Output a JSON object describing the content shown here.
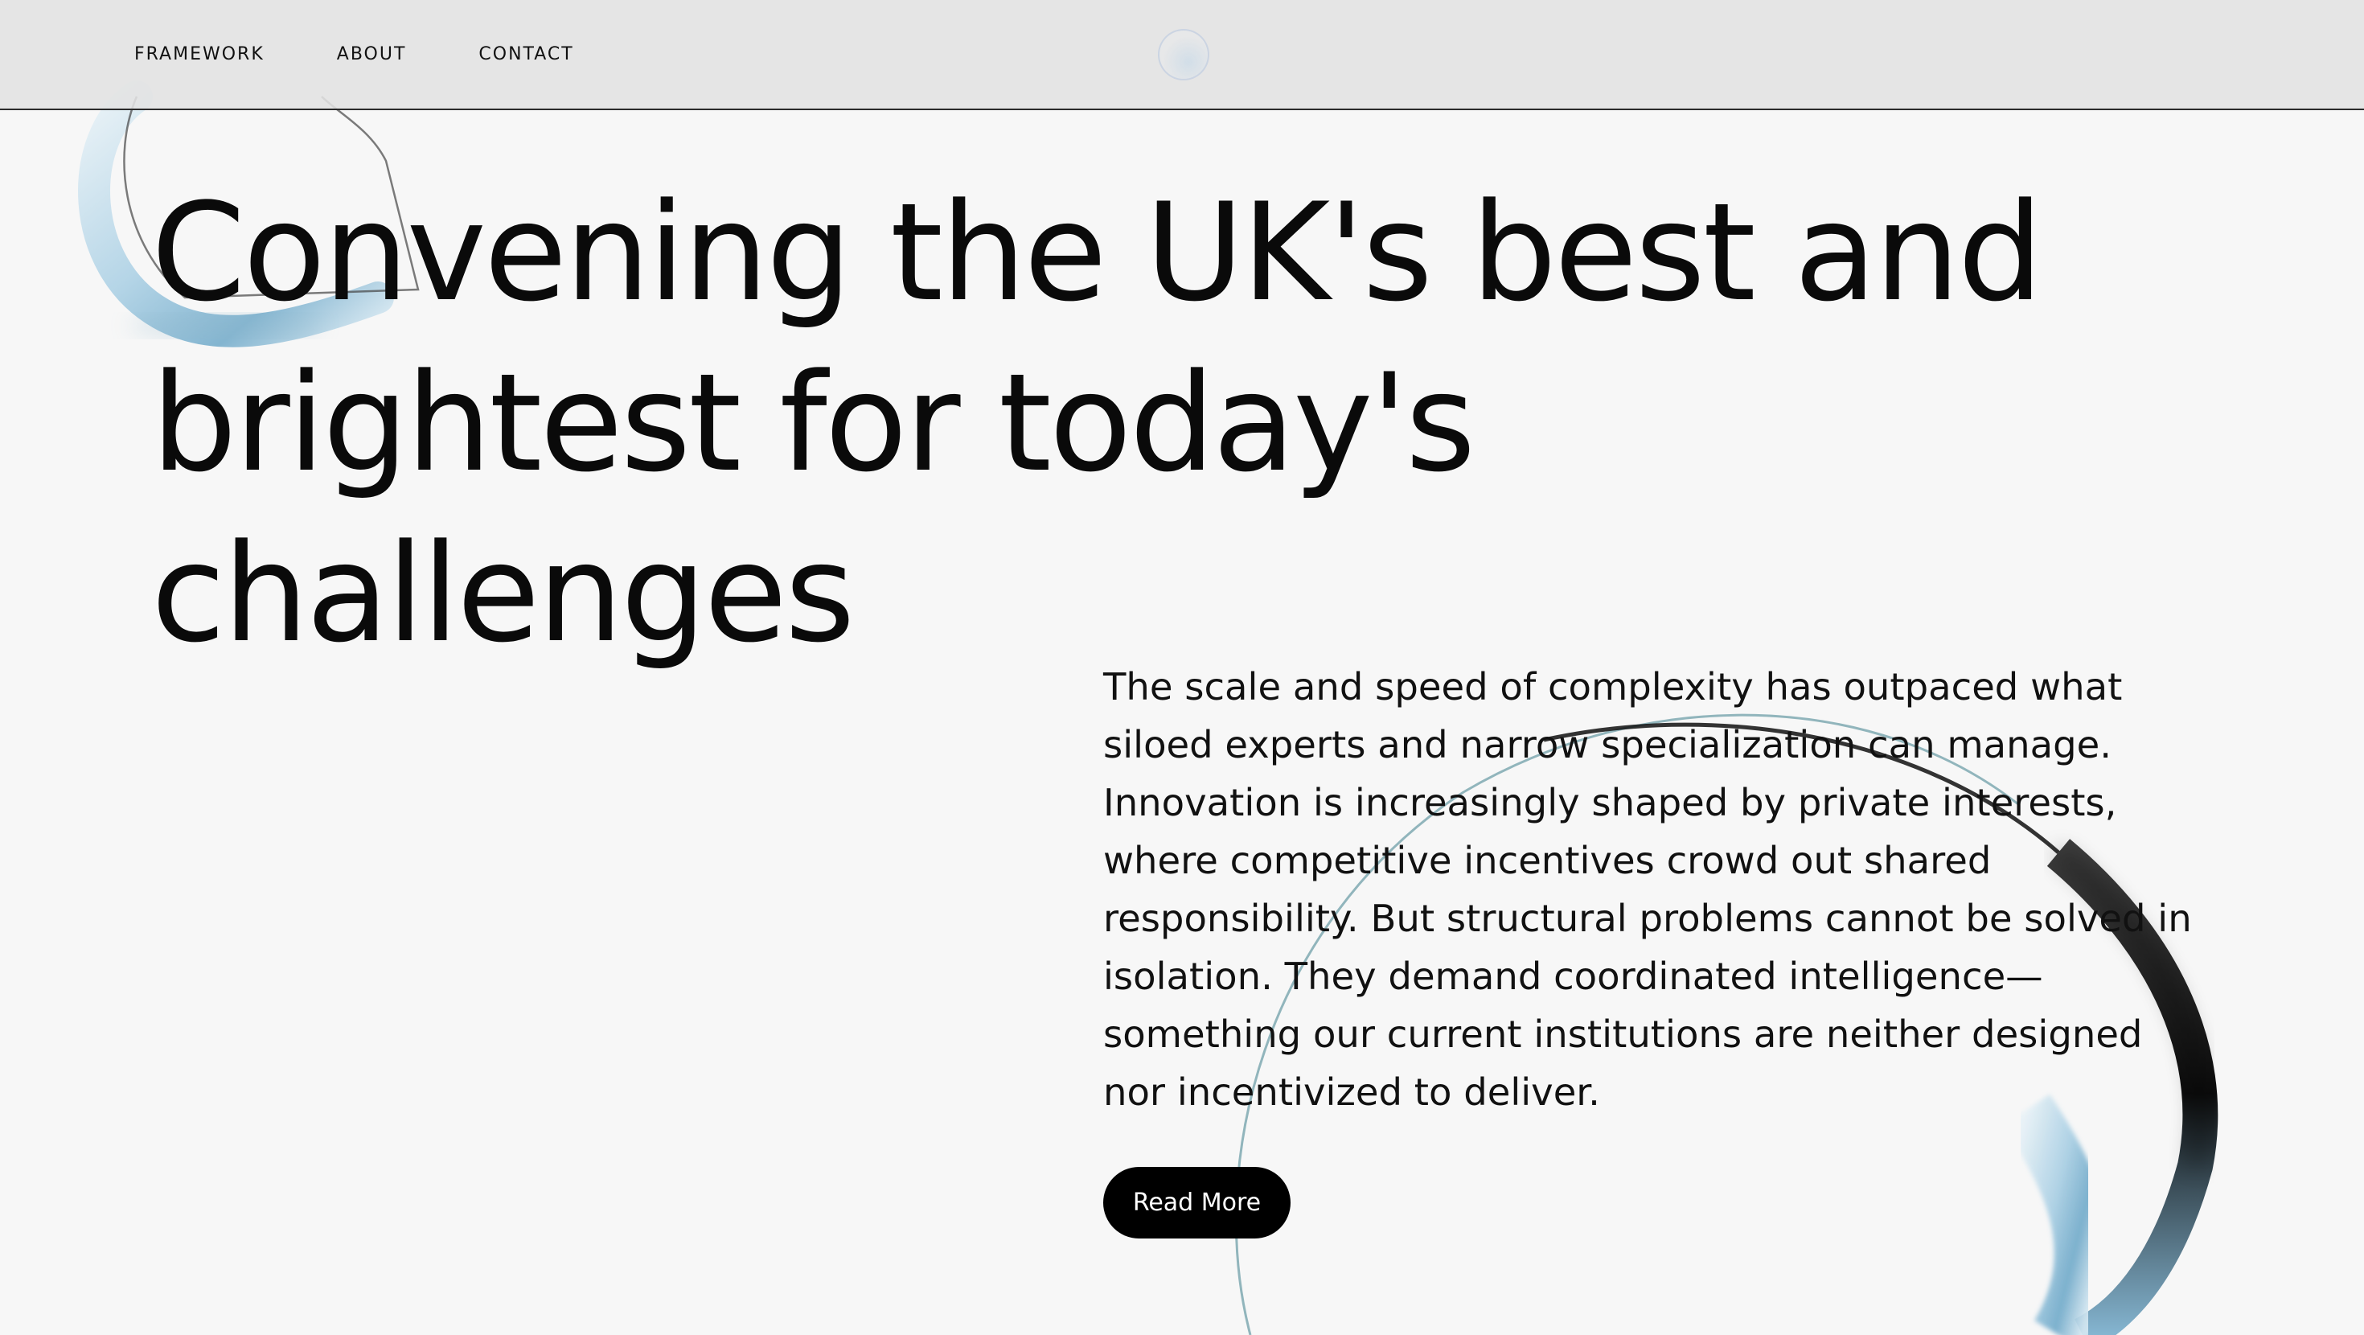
{
  "nav": {
    "items": [
      {
        "label": "FRAMEWORK"
      },
      {
        "label": "ABOUT"
      },
      {
        "label": "CONTACT"
      }
    ]
  },
  "hero": {
    "title_line1": "Convening the UK's best and",
    "title_line2": "brightest for today's challenges"
  },
  "intro": {
    "text": "The scale and speed of complexity has outpaced what siloed experts and narrow specialization can manage. Innovation is increasingly shaped by private interests, where competitive incentives crowd out shared responsibility. But structural problems cannot be solved in isolation. They demand coordinated intelligence—something our current institutions are neither designed nor incentivized to deliver.",
    "button_label": "Read More"
  },
  "colors": {
    "background": "#f7f7f7",
    "topbar": "#e2e2e2",
    "text": "#0a0a0a",
    "button_bg": "#000000",
    "button_text": "#ffffff",
    "ring_accent": "#8fbfd9"
  }
}
